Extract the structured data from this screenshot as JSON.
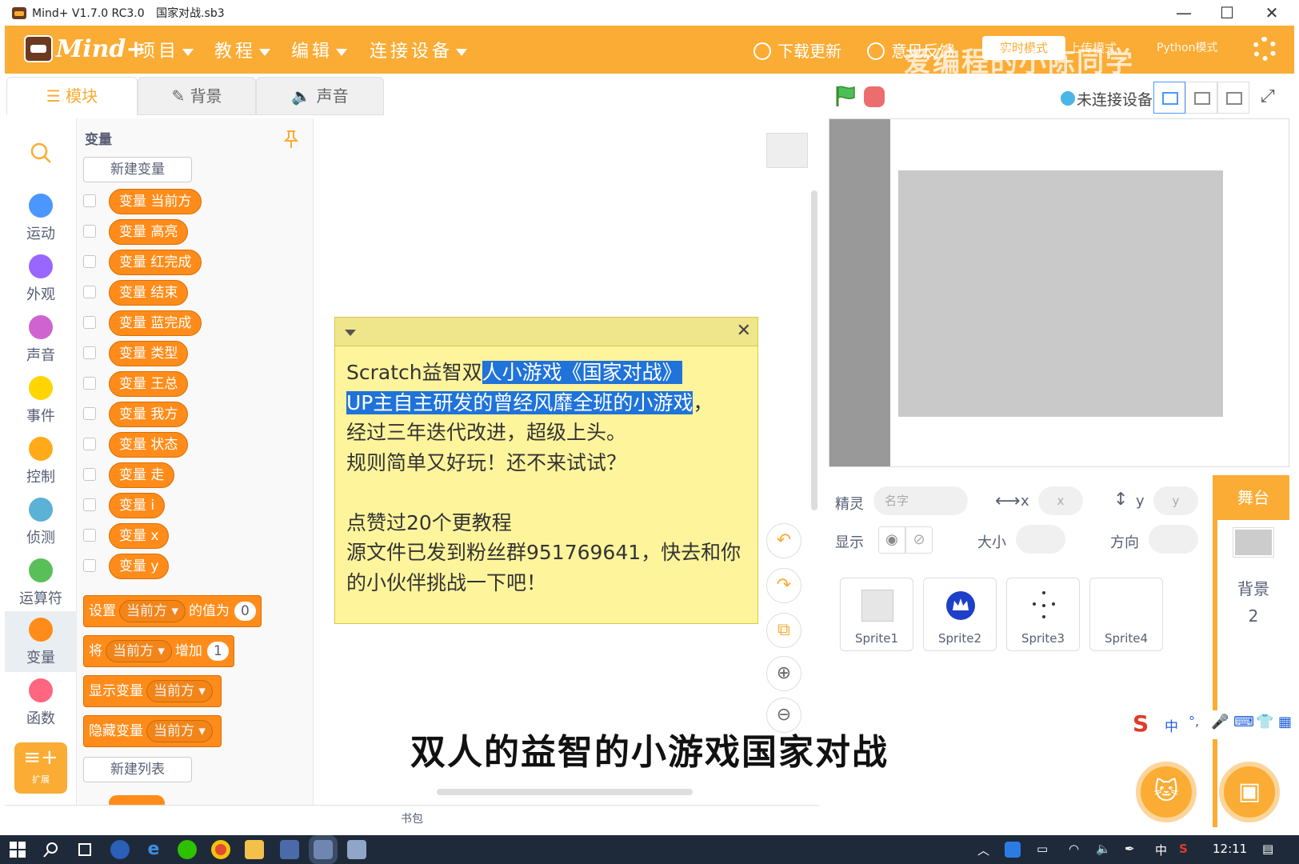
{
  "window": {
    "app_title": "Mind+ V1.7.0 RC3.0",
    "file_name": "国家对战.sb3",
    "minimize": "—",
    "maximize": "☐",
    "close": "✕"
  },
  "menubar": {
    "logo_text": "Mind+",
    "items": [
      "项目",
      "教程",
      "编辑",
      "连接设备"
    ],
    "download_update": "下载更新",
    "feedback": "意见反馈",
    "mode_online": "实时模式",
    "mode_upload": "上传模式",
    "mode_python": "Python模式",
    "watermark": "爱编程的小陈同学"
  },
  "tabs": {
    "blocks": "模块",
    "backdrops": "背景",
    "sounds": "声音"
  },
  "device": {
    "status": "未连接设备"
  },
  "categories": [
    {
      "label": "运动",
      "color": "#4c97ff"
    },
    {
      "label": "外观",
      "color": "#9966ff"
    },
    {
      "label": "声音",
      "color": "#cf63cf"
    },
    {
      "label": "事件",
      "color": "#ffd500"
    },
    {
      "label": "控制",
      "color": "#ffab19"
    },
    {
      "label": "侦测",
      "color": "#5cb1d6"
    },
    {
      "label": "运算符",
      "color": "#59c059"
    },
    {
      "label": "变量",
      "color": "#ff8c1a"
    },
    {
      "label": "函数",
      "color": "#ff6680"
    }
  ],
  "extension_label": "扩展",
  "palette": {
    "title": "变量",
    "new_variable": "新建变量",
    "variables": [
      "变量 当前方",
      "变量 高亮",
      "变量 红完成",
      "变量 结束",
      "变量 蓝完成",
      "变量 类型",
      "变量 王总",
      "变量 我方",
      "变量 状态",
      "变量 走",
      "变量 i",
      "变量 x",
      "变量 y"
    ],
    "set_block": {
      "prefix": "设置",
      "var": "当前方 ▾",
      "middle": "的值为",
      "value": "0"
    },
    "change_block": {
      "prefix": "将",
      "var": "当前方 ▾",
      "middle": "增加",
      "value": "1"
    },
    "show_block": {
      "prefix": "显示变量",
      "var": "当前方 ▾"
    },
    "hide_block": {
      "prefix": "隐藏变量",
      "var": "当前方 ▾"
    },
    "new_list": "新建列表"
  },
  "comment": {
    "line1_pre": "Scratch益智双",
    "line1_hl": "人小游戏《国家对战》",
    "line2_hl": "UP主自主研发的曾经风靡全班的小游戏",
    "line2_post": "，",
    "line3": "经过三年迭代改进，超级上头。",
    "line4": "规则简单又好玩！还不来试试？",
    "line6": "点赞过20个更教程",
    "line7": "源文件已发到粉丝群951769641，快去和你",
    "line8": "的小伙伴挑战一下吧！"
  },
  "subtitle": "双人的益智的小游戏国家对战",
  "backpack": "书包",
  "sprite_info": {
    "sprite_label": "精灵",
    "name_placeholder": "名字",
    "x_label": "x",
    "x_placeholder": "x",
    "y_label": "y",
    "y_placeholder": "y",
    "show_label": "显示",
    "size_label": "大小",
    "direction_label": "方向"
  },
  "sprites": [
    "Sprite1",
    "Sprite2",
    "Sprite3",
    "Sprite4"
  ],
  "stage_panel": {
    "title": "舞台",
    "backdrops_label": "背景",
    "backdrops_count": "2"
  },
  "ime": {
    "lang": "中"
  },
  "taskbar": {
    "ime_lang": "中",
    "clock": "12:11"
  }
}
